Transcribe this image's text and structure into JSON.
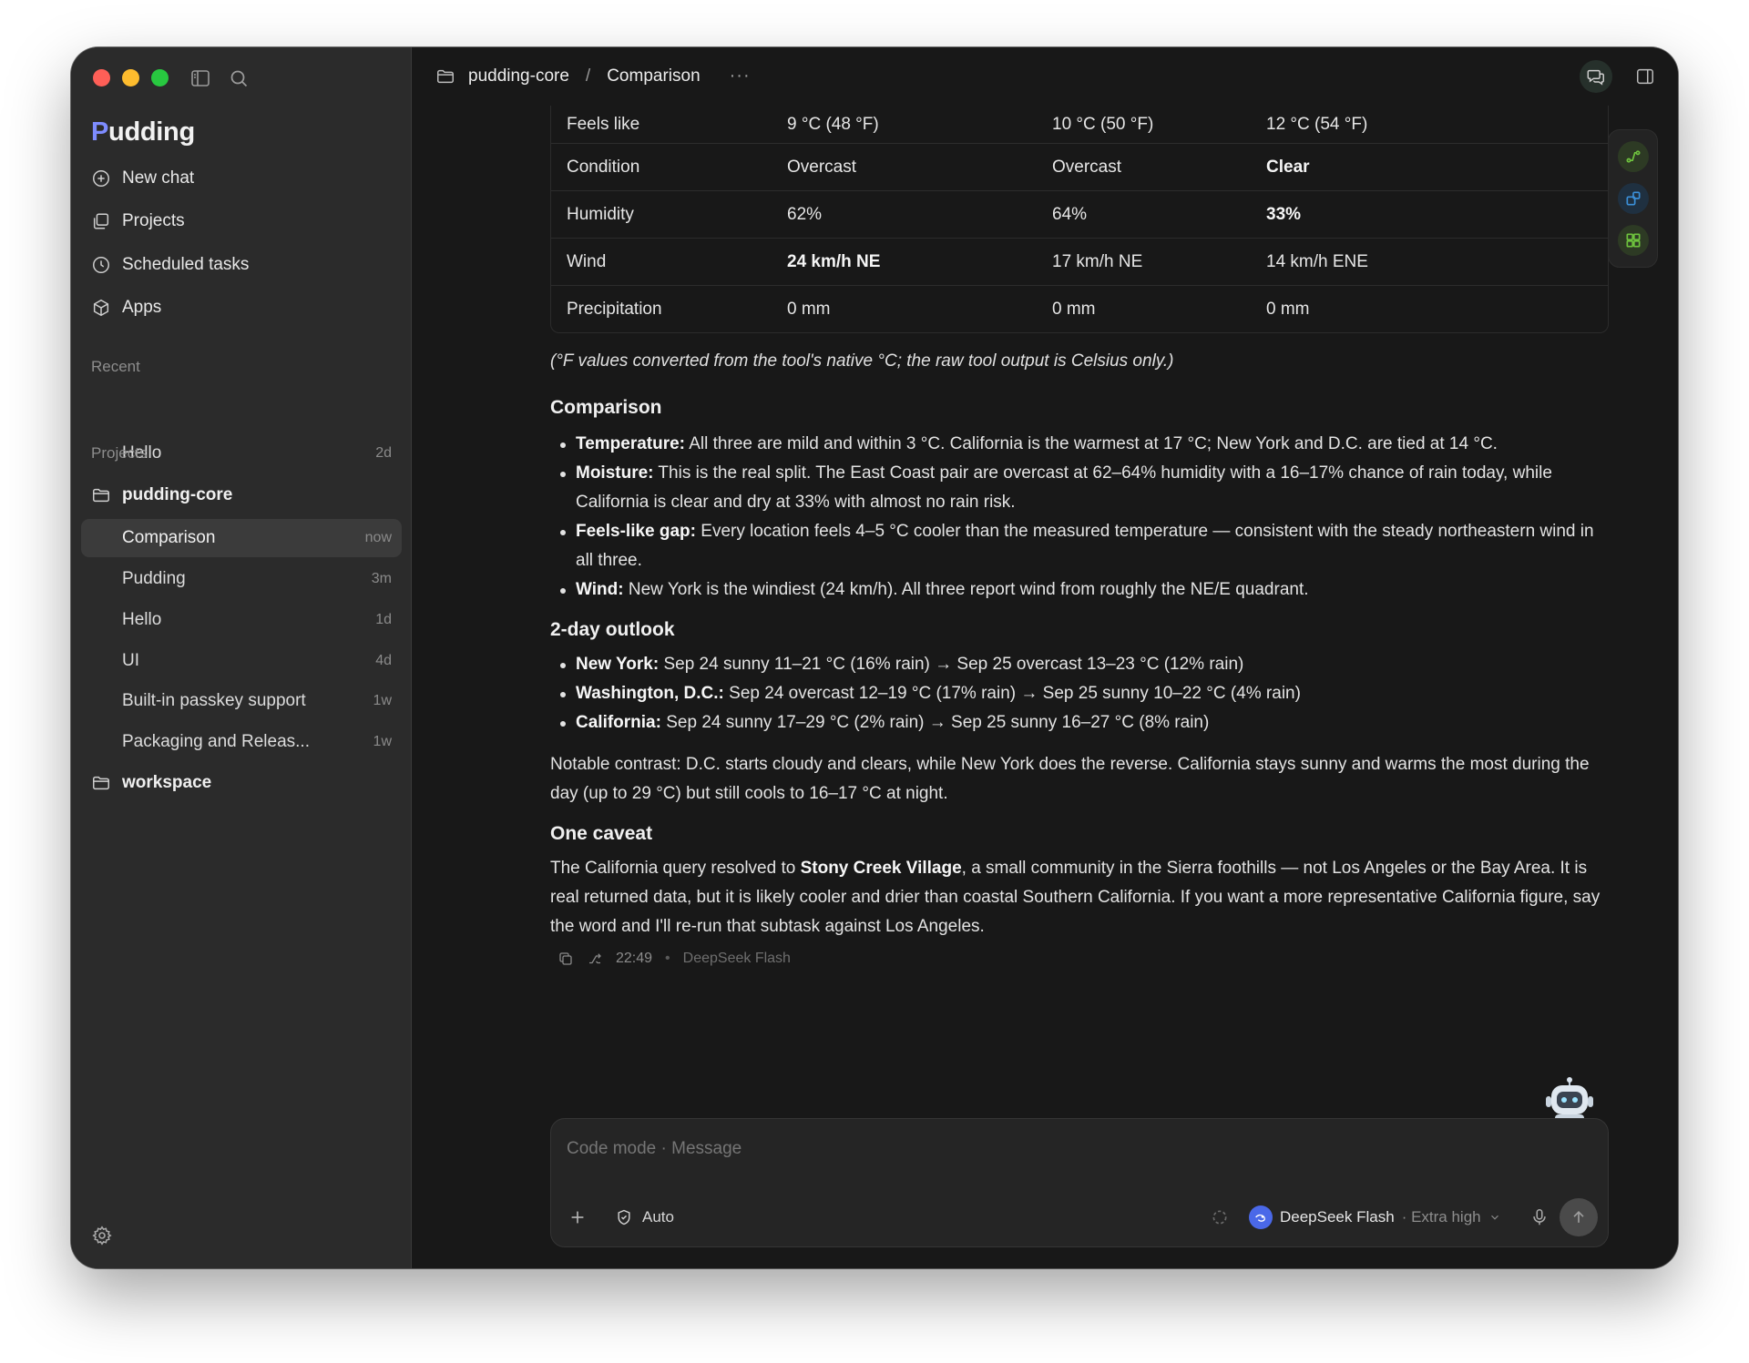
{
  "app": {
    "logo_first": "P",
    "logo_rest": "udding"
  },
  "sidebar": {
    "nav": [
      {
        "label": "New chat",
        "icon": "plus-circle-icon"
      },
      {
        "label": "Projects",
        "icon": "projects-icon"
      },
      {
        "label": "Scheduled tasks",
        "icon": "clock-icon"
      },
      {
        "label": "Apps",
        "icon": "box-icon"
      }
    ],
    "recent_label": "Recent",
    "recent": [
      {
        "title": "Hello",
        "age": "2d"
      }
    ],
    "projects_label": "Projects",
    "projects": [
      {
        "name": "pudding-core",
        "chats": [
          {
            "title": "Comparison",
            "age": "now"
          },
          {
            "title": "Pudding",
            "age": "3m"
          },
          {
            "title": "Hello",
            "age": "1d"
          },
          {
            "title": "UI",
            "age": "4d"
          },
          {
            "title": "Built-in passkey support",
            "age": "1w"
          },
          {
            "title": "Packaging and Releas...",
            "age": "1w"
          }
        ]
      },
      {
        "name": "workspace",
        "chats": []
      }
    ]
  },
  "topbar": {
    "project": "pudding-core",
    "separator": "/",
    "chat": "Comparison",
    "more": "···"
  },
  "table": {
    "rows": [
      {
        "label": "Feels like",
        "cells": [
          {
            "v": "9 °C (48 °F)",
            "b": false
          },
          {
            "v": "10 °C (50 °F)",
            "b": false
          },
          {
            "v": "12 °C (54 °F)",
            "b": false
          }
        ]
      },
      {
        "label": "Condition",
        "cells": [
          {
            "v": "Overcast",
            "b": false
          },
          {
            "v": "Overcast",
            "b": false
          },
          {
            "v": "Clear",
            "b": true
          }
        ]
      },
      {
        "label": "Humidity",
        "cells": [
          {
            "v": "62%",
            "b": false
          },
          {
            "v": "64%",
            "b": false
          },
          {
            "v": "33%",
            "b": true
          }
        ]
      },
      {
        "label": "Wind",
        "cells": [
          {
            "v": "24 km/h NE",
            "b": true
          },
          {
            "v": "17 km/h NE",
            "b": false
          },
          {
            "v": "14 km/h ENE",
            "b": false
          }
        ]
      },
      {
        "label": "Precipitation",
        "cells": [
          {
            "v": "0 mm",
            "b": false
          },
          {
            "v": "0 mm",
            "b": false
          },
          {
            "v": "0 mm",
            "b": false
          }
        ]
      }
    ]
  },
  "message": {
    "note": "(°F values converted from the tool's native °C; the raw tool output is Celsius only.)",
    "comparison": {
      "heading": "Comparison",
      "items": [
        {
          "lead": "Temperature:",
          "text": " All three are mild and within 3 °C. California is the warmest at 17 °C; New York and D.C. are tied at 14 °C."
        },
        {
          "lead": "Moisture:",
          "text": " This is the real split. The East Coast pair are overcast at 62–64% humidity with a 16–17% chance of rain today, while California is clear and dry at 33% with almost no rain risk."
        },
        {
          "lead": "Feels-like gap:",
          "text": " Every location feels 4–5 °C cooler than the measured temperature — consistent with the steady northeastern wind in all three."
        },
        {
          "lead": "Wind:",
          "text": " New York is the windiest (24 km/h). All three report wind from roughly the NE/E quadrant."
        }
      ]
    },
    "outlook": {
      "heading": "2-day outlook",
      "items": [
        {
          "lead": "New York:",
          "text": " Sep 24 sunny 11–21 °C (16% rain) → Sep 25 overcast 13–23 °C (12% rain)"
        },
        {
          "lead": "Washington, D.C.:",
          "text": " Sep 24 overcast 12–19 °C (17% rain) → Sep 25 sunny 10–22 °C (4% rain)"
        },
        {
          "lead": "California:",
          "text": " Sep 24 sunny 17–29 °C (2% rain) → Sep 25 sunny 16–27 °C (8% rain)"
        }
      ]
    },
    "contrast": "Notable contrast: D.C. starts cloudy and clears, while New York does the reverse. California stays sunny and warms the most during the day (up to 29 °C) but still cools to 16–17 °C at night.",
    "caveat": {
      "heading": "One caveat",
      "before": "The California query resolved to ",
      "bold": "Stony Creek Village",
      "after": ", a small community in the Sierra foothills — not Los Angeles or the Bay Area. It is real returned data, but it is likely cooler and drier than coastal Southern California. If you want a more representative California figure, say the word and I'll re-run that subtask against Los Angeles."
    },
    "meta": {
      "time": "22:49",
      "dot": "•",
      "model": "DeepSeek Flash"
    }
  },
  "composer": {
    "placeholder": "Code mode · Message",
    "mode": "Auto",
    "model": "DeepSeek Flash",
    "effort": "· Extra high"
  },
  "colors": {
    "accent_green": "#5fbf3a",
    "accent_blue": "#3b8fd8",
    "logo_p": "#7e8cff",
    "model_badge": "#4a68e8"
  }
}
